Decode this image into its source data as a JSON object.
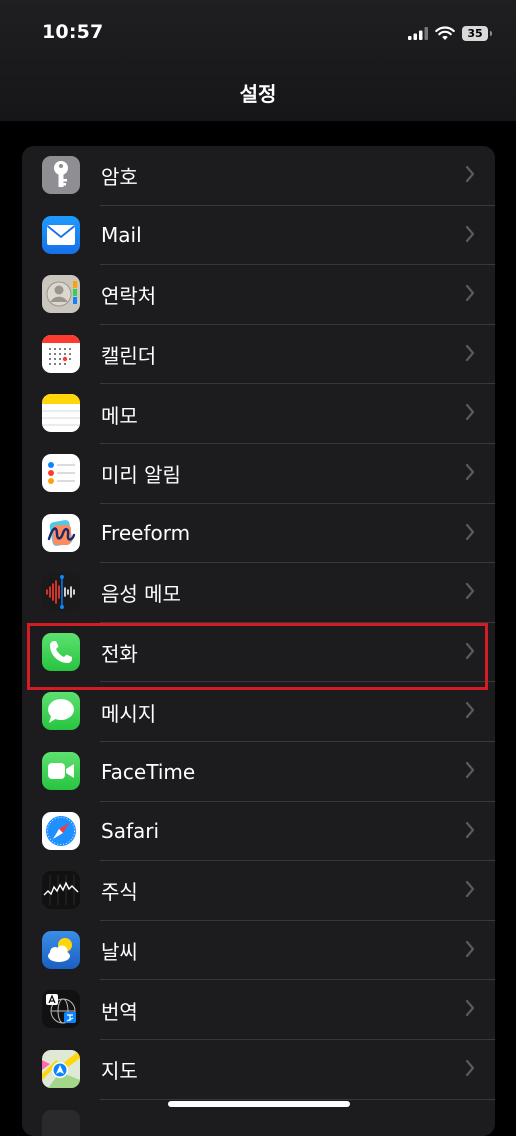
{
  "status_bar": {
    "time": "10:57",
    "battery": "35"
  },
  "header": {
    "title": "설정"
  },
  "items": [
    {
      "label": "암호",
      "icon": "key-icon"
    },
    {
      "label": "Mail",
      "icon": "mail-icon"
    },
    {
      "label": "연락처",
      "icon": "contacts-icon"
    },
    {
      "label": "캘린더",
      "icon": "calendar-icon"
    },
    {
      "label": "메모",
      "icon": "notes-icon"
    },
    {
      "label": "미리 알림",
      "icon": "reminders-icon"
    },
    {
      "label": "Freeform",
      "icon": "freeform-icon"
    },
    {
      "label": "음성 메모",
      "icon": "voice-memos-icon"
    },
    {
      "label": "전화",
      "icon": "phone-icon"
    },
    {
      "label": "메시지",
      "icon": "messages-icon"
    },
    {
      "label": "FaceTime",
      "icon": "facetime-icon"
    },
    {
      "label": "Safari",
      "icon": "safari-icon"
    },
    {
      "label": "주식",
      "icon": "stocks-icon"
    },
    {
      "label": "날씨",
      "icon": "weather-icon"
    },
    {
      "label": "번역",
      "icon": "translate-icon"
    },
    {
      "label": "지도",
      "icon": "maps-icon"
    }
  ],
  "highlight": {
    "item": "전화",
    "color": "#d41c25"
  }
}
